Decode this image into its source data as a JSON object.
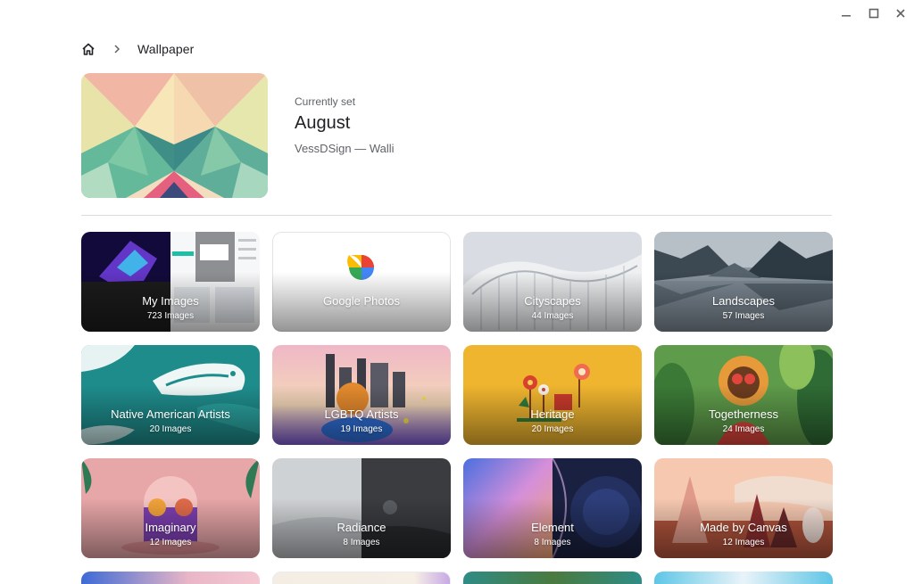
{
  "breadcrumb": {
    "current": "Wallpaper"
  },
  "current": {
    "label": "Currently set",
    "title": "August",
    "artist": "VessDSign — Walli"
  },
  "collections": [
    {
      "title": "My Images",
      "count": "723 Images"
    },
    {
      "title": "Google Photos",
      "count": ""
    },
    {
      "title": "Cityscapes",
      "count": "44 Images"
    },
    {
      "title": "Landscapes",
      "count": "57 Images"
    },
    {
      "title": "Native American Artists",
      "count": "20 Images"
    },
    {
      "title": "LGBTQ Artists",
      "count": "19 Images"
    },
    {
      "title": "Heritage",
      "count": "20 Images"
    },
    {
      "title": "Togetherness",
      "count": "24 Images"
    },
    {
      "title": "Imaginary",
      "count": "12 Images"
    },
    {
      "title": "Radiance",
      "count": "8 Images"
    },
    {
      "title": "Element",
      "count": "8 Images"
    },
    {
      "title": "Made by Canvas",
      "count": "12 Images"
    }
  ],
  "colors": {
    "accent": "#1a73e8",
    "text_primary": "#202124",
    "text_secondary": "#5f6368",
    "divider": "#dadce0"
  },
  "icons": [
    "minimize-icon",
    "maximize-icon",
    "close-icon",
    "home-icon",
    "chevron-right-icon",
    "google-photos-icon"
  ]
}
